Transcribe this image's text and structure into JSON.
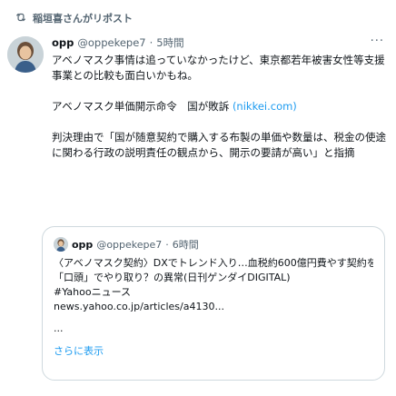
{
  "repost": {
    "label": "稲垣喜さんがリポスト"
  },
  "tweet": {
    "name": "opp",
    "handle": "@oppekepe7",
    "separator": "·",
    "time": "5時間",
    "more": "···",
    "para1": "アベノマスク事情は追っていなかったけど、東京都若年被害女性等支援事業との比較も面白いかもね。",
    "para2_text": "アベノマスク単価開示命令　国が敗訴 ",
    "para2_link": "(nikkei.com)",
    "para3": "判決理由で「国が随意契約で購入する布製の単価や数量は、税金の使途に関わる行政の説明責任の観点から、開示の要請が高い」と指摘"
  },
  "quote": {
    "name": "opp",
    "handle": "@oppekepe7",
    "separator": "·",
    "time": "6時間",
    "line1": "〈アベノマスク契約〉DXでトレンド入り…血税約600億円費やす契約を",
    "line2": "「口頭」でやり取り？の異常(日刊ゲンダイDIGITAL)",
    "line3": "#Yahooニュース",
    "line4": "news.yahoo.co.jp/articles/a4130...",
    "ellipsis": "...",
    "show_more": "さらに表示"
  }
}
